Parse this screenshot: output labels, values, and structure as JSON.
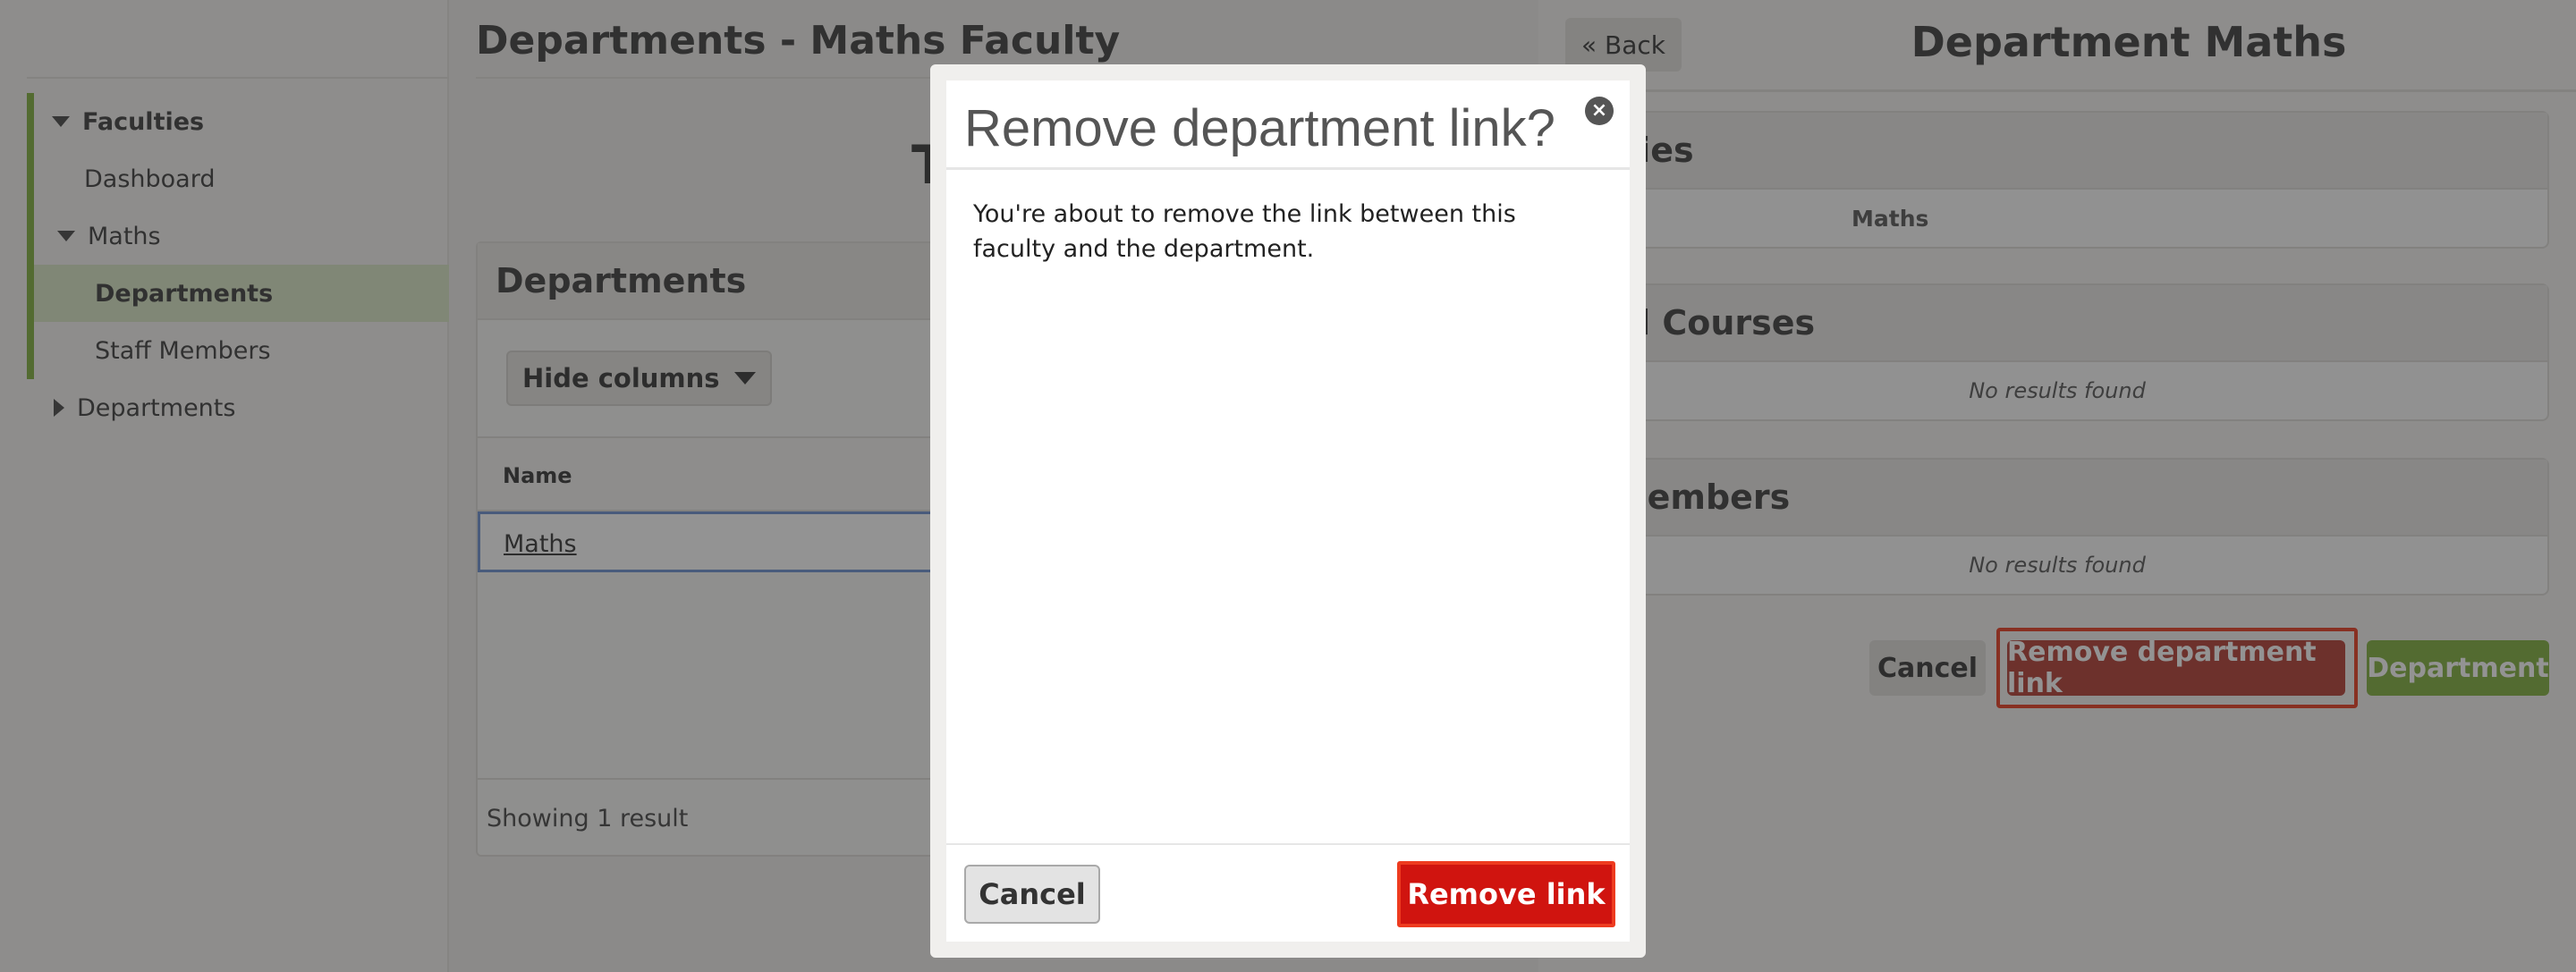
{
  "sidebar": {
    "tree": {
      "faculties": "Faculties",
      "dashboard": "Dashboard",
      "maths": "Maths",
      "departments_active": "Departments",
      "staff_members": "Staff Members",
      "departments_root": "Departments"
    }
  },
  "main": {
    "title": "Departments - Maths Faculty",
    "obscured_heading_letter": "T",
    "panel": {
      "title": "Departments",
      "hide_columns_label": "Hide columns",
      "column_name": "Name",
      "rows": [
        {
          "name": "Maths"
        }
      ],
      "footer": "Showing 1 result"
    }
  },
  "right_panel": {
    "back_label": "« Back",
    "title": "Department Maths",
    "faculties_heading": "ulties",
    "faculties_value": "Maths",
    "courses_heading": "ted Courses",
    "courses_empty": "No results found",
    "staff_heading": "f Members",
    "staff_empty": "No results found",
    "buttons": {
      "cancel": "Cancel",
      "remove_link": "Remove department link",
      "department": "Department"
    }
  },
  "modal": {
    "title": "Remove department link?",
    "close_icon": "close-icon",
    "body": "You're about to remove the link between this faculty and the department.",
    "cancel_label": "Cancel",
    "confirm_label": "Remove link"
  },
  "colors": {
    "accent_green": "#7fae3b",
    "danger_red": "#d0140f",
    "highlight_outline": "#e8391d"
  }
}
